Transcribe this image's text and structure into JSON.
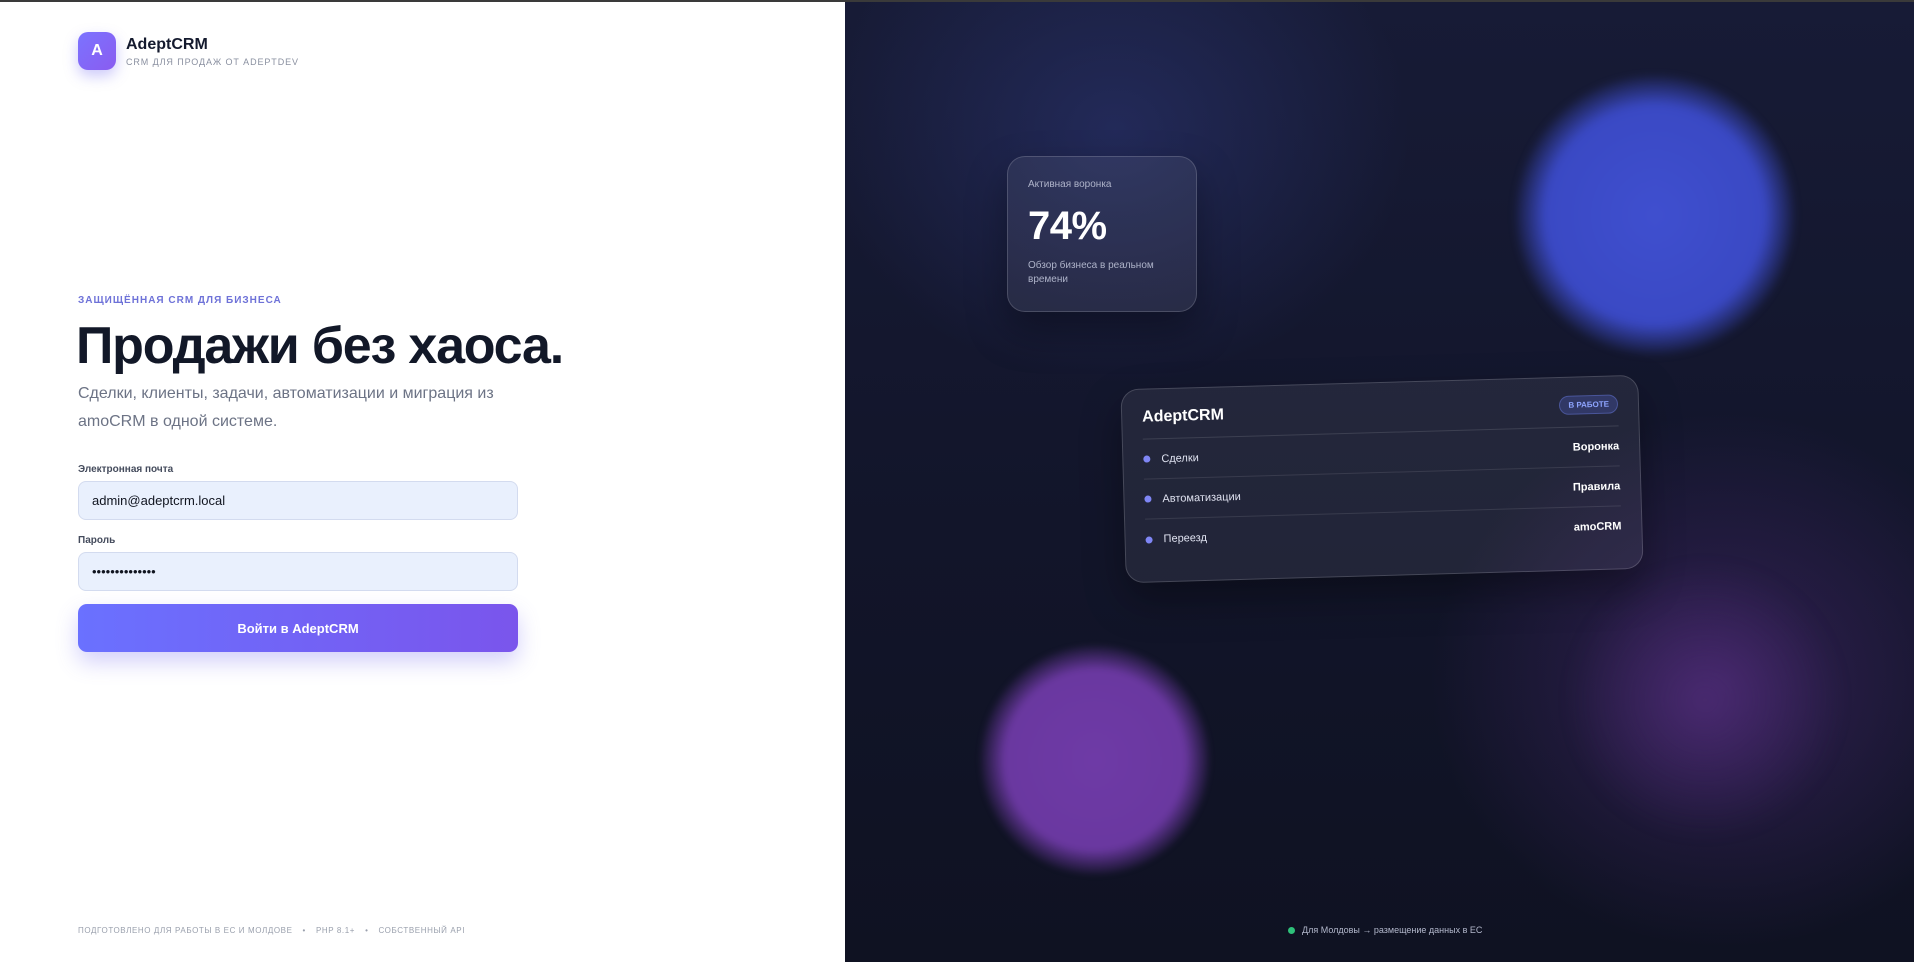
{
  "brand": {
    "logo_letter": "A",
    "name": "AdeptCRM",
    "subtitle": "CRM ДЛЯ ПРОДАЖ ОТ ADEPTDEV"
  },
  "hero": {
    "eyebrow": "ЗАЩИЩЁННАЯ CRM ДЛЯ БИЗНЕСА",
    "headline": "Продажи без хаоса.",
    "lead": "Сделки, клиенты, задачи, автоматизации и миграция из amoCRM в одной системе."
  },
  "form": {
    "email_label": "Электронная почта",
    "email_value": "admin@adeptcrm.local",
    "password_label": "Пароль",
    "password_value": "••••••••••••••",
    "submit_label": "Войти в AdeptCRM"
  },
  "footer_left": {
    "items": [
      "ПОДГОТОВЛЕНО ДЛЯ РАБОТЫ В ЕС И МОЛДОВЕ",
      "PHP 8.1+",
      "СОБСТВЕННЫЙ API"
    ],
    "separator": "•"
  },
  "metric_card": {
    "label": "Активная воронка",
    "value": "74%",
    "description": "Обзор бизнеса в реальном времени"
  },
  "crm_card": {
    "title": "AdeptCRM",
    "badge": "В РАБОТЕ",
    "rows": [
      {
        "label": "Сделки",
        "value": "Воронка"
      },
      {
        "label": "Автоматизации",
        "value": "Правила"
      },
      {
        "label": "Переезд",
        "value": "amoCRM"
      }
    ]
  },
  "footer_right": {
    "status_text": "Для Молдовы → размещение данных в ЕС"
  },
  "colors": {
    "accent": "#6a71ff",
    "accent_end": "#7a55ec",
    "status_green": "#2ec17a",
    "dark_panel": "#12152a"
  }
}
